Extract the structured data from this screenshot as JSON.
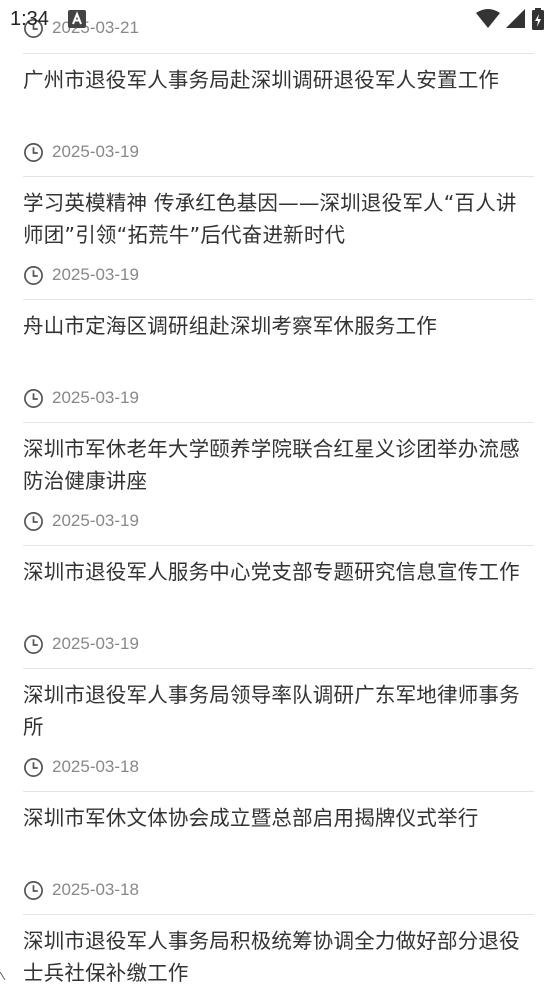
{
  "status_bar": {
    "time": "1:34"
  },
  "top_date": "2025-03-21",
  "articles": [
    {
      "title": "广州市退役军人事务局赴深圳调研退役军人安置工作",
      "date": "2025-03-19"
    },
    {
      "title": "学习英模精神 传承红色基因——深圳退役军人“百人讲师团”引领“拓荒牛”后代奋进新时代",
      "date": "2025-03-19"
    },
    {
      "title": "舟山市定海区调研组赴深圳考察军休服务工作",
      "date": "2025-03-19"
    },
    {
      "title": "深圳市军休老年大学颐养学院联合红星义诊团举办流感防治健康讲座",
      "date": "2025-03-19"
    },
    {
      "title": "深圳市退役军人服务中心党支部专题研究信息宣传工作",
      "date": "2025-03-19"
    },
    {
      "title": "深圳市退役军人事务局领导率队调研广东军地律师事务所",
      "date": "2025-03-18"
    },
    {
      "title": "深圳市军休文体协会成立暨总部启用揭牌仪式举行",
      "date": "2025-03-18"
    },
    {
      "title": "深圳市退役军人事务局积极统筹协调全力做好部分退役士兵社保补缴工作",
      "date": ""
    }
  ]
}
